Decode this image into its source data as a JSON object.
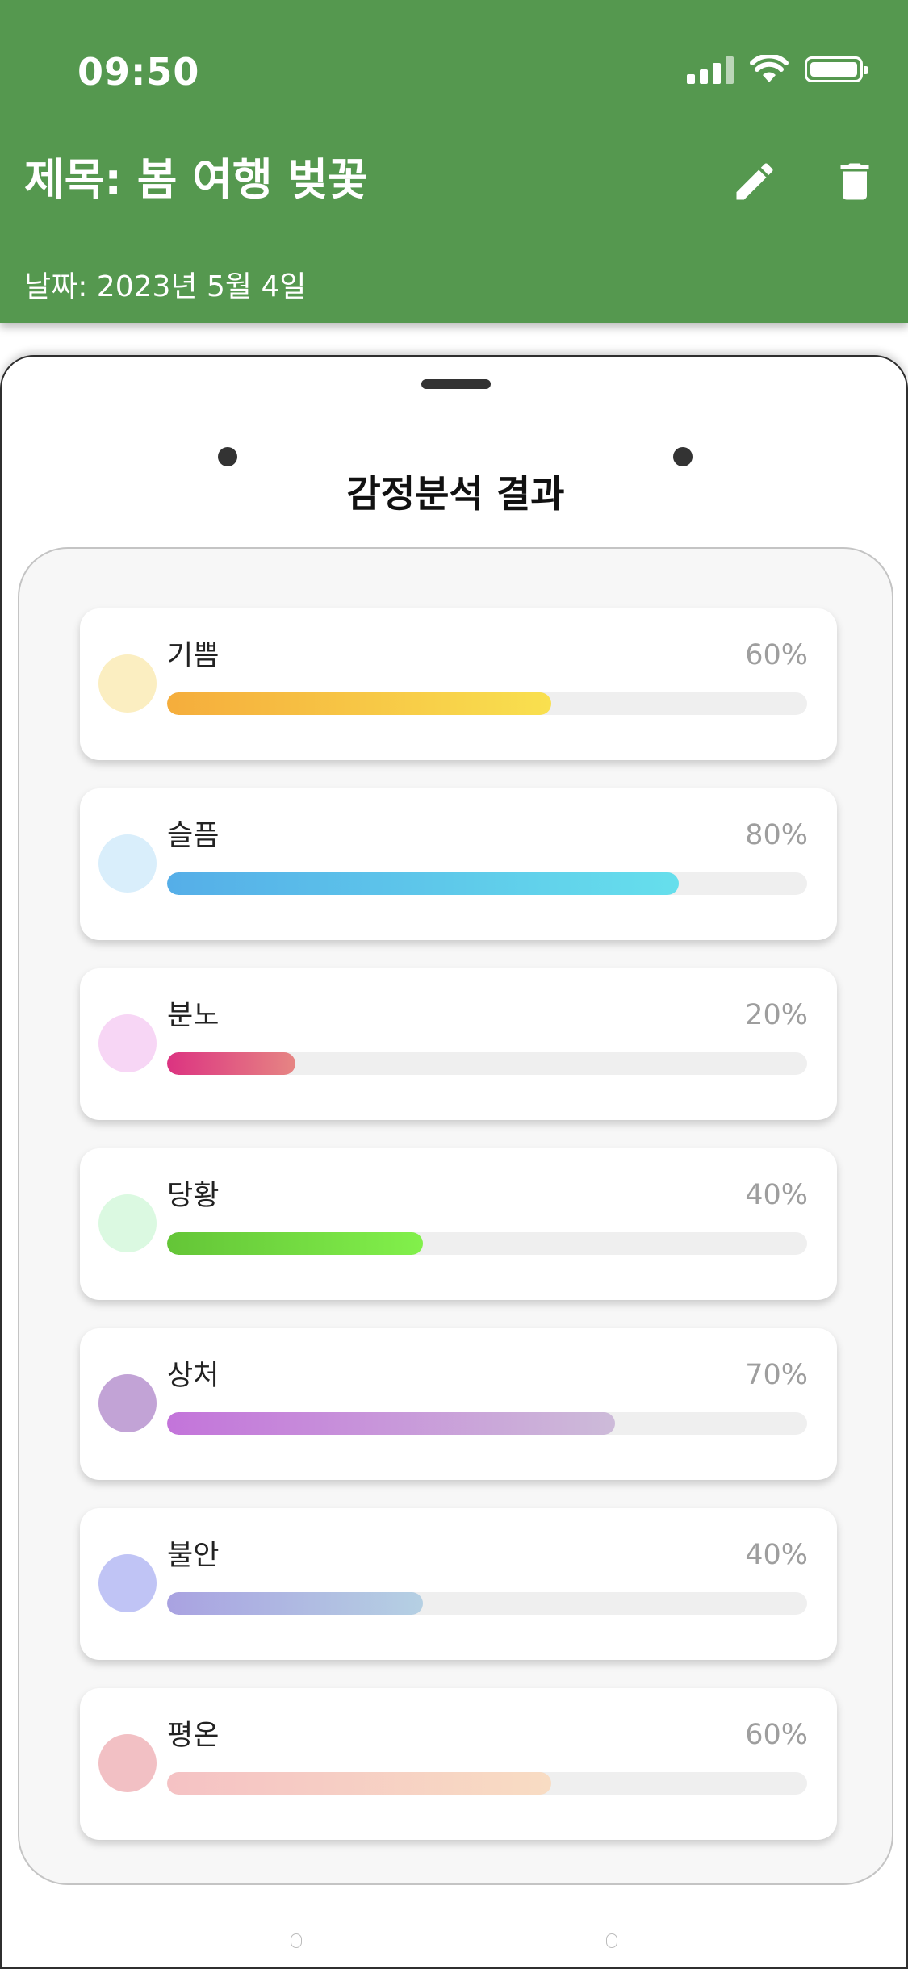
{
  "status_bar": {
    "time": "09:50"
  },
  "header": {
    "title": "제목: 봄 여행 벚꽃",
    "date": "날짜: 2023년 5월 4일",
    "edit_icon": "pencil-icon",
    "delete_icon": "trash-icon",
    "background": "#55984f"
  },
  "sheet": {
    "title": "감정분석 결과"
  },
  "emotions": [
    {
      "label": "기쁨",
      "percent_text": "60%",
      "value": 0.6,
      "icon_color": "#fbeec1",
      "bar_from": "#f5ad3c",
      "bar_to": "#f9e04f"
    },
    {
      "label": "슬픔",
      "percent_text": "80%",
      "value": 0.8,
      "icon_color": "#d9eefb",
      "bar_from": "#55aee8",
      "bar_to": "#66dfec"
    },
    {
      "label": "분노",
      "percent_text": "20%",
      "value": 0.2,
      "icon_color": "#f7d6f5",
      "bar_from": "#dc3381",
      "bar_to": "#e68583"
    },
    {
      "label": "당황",
      "percent_text": "40%",
      "value": 0.4,
      "icon_color": "#dbf9e1",
      "bar_from": "#64c537",
      "bar_to": "#82f04b"
    },
    {
      "label": "상처",
      "percent_text": "70%",
      "value": 0.7,
      "icon_color": "#c2a3d6",
      "bar_from": "#c374da",
      "bar_to": "#cdbbd9"
    },
    {
      "label": "불안",
      "percent_text": "40%",
      "value": 0.4,
      "icon_color": "#c0c4f5",
      "bar_from": "#a9a2e1",
      "bar_to": "#b5d0e3"
    },
    {
      "label": "평온",
      "percent_text": "60%",
      "value": 0.6,
      "icon_color": "#f2c0c4",
      "bar_from": "#f5c2c4",
      "bar_to": "#f8dcc3"
    }
  ]
}
